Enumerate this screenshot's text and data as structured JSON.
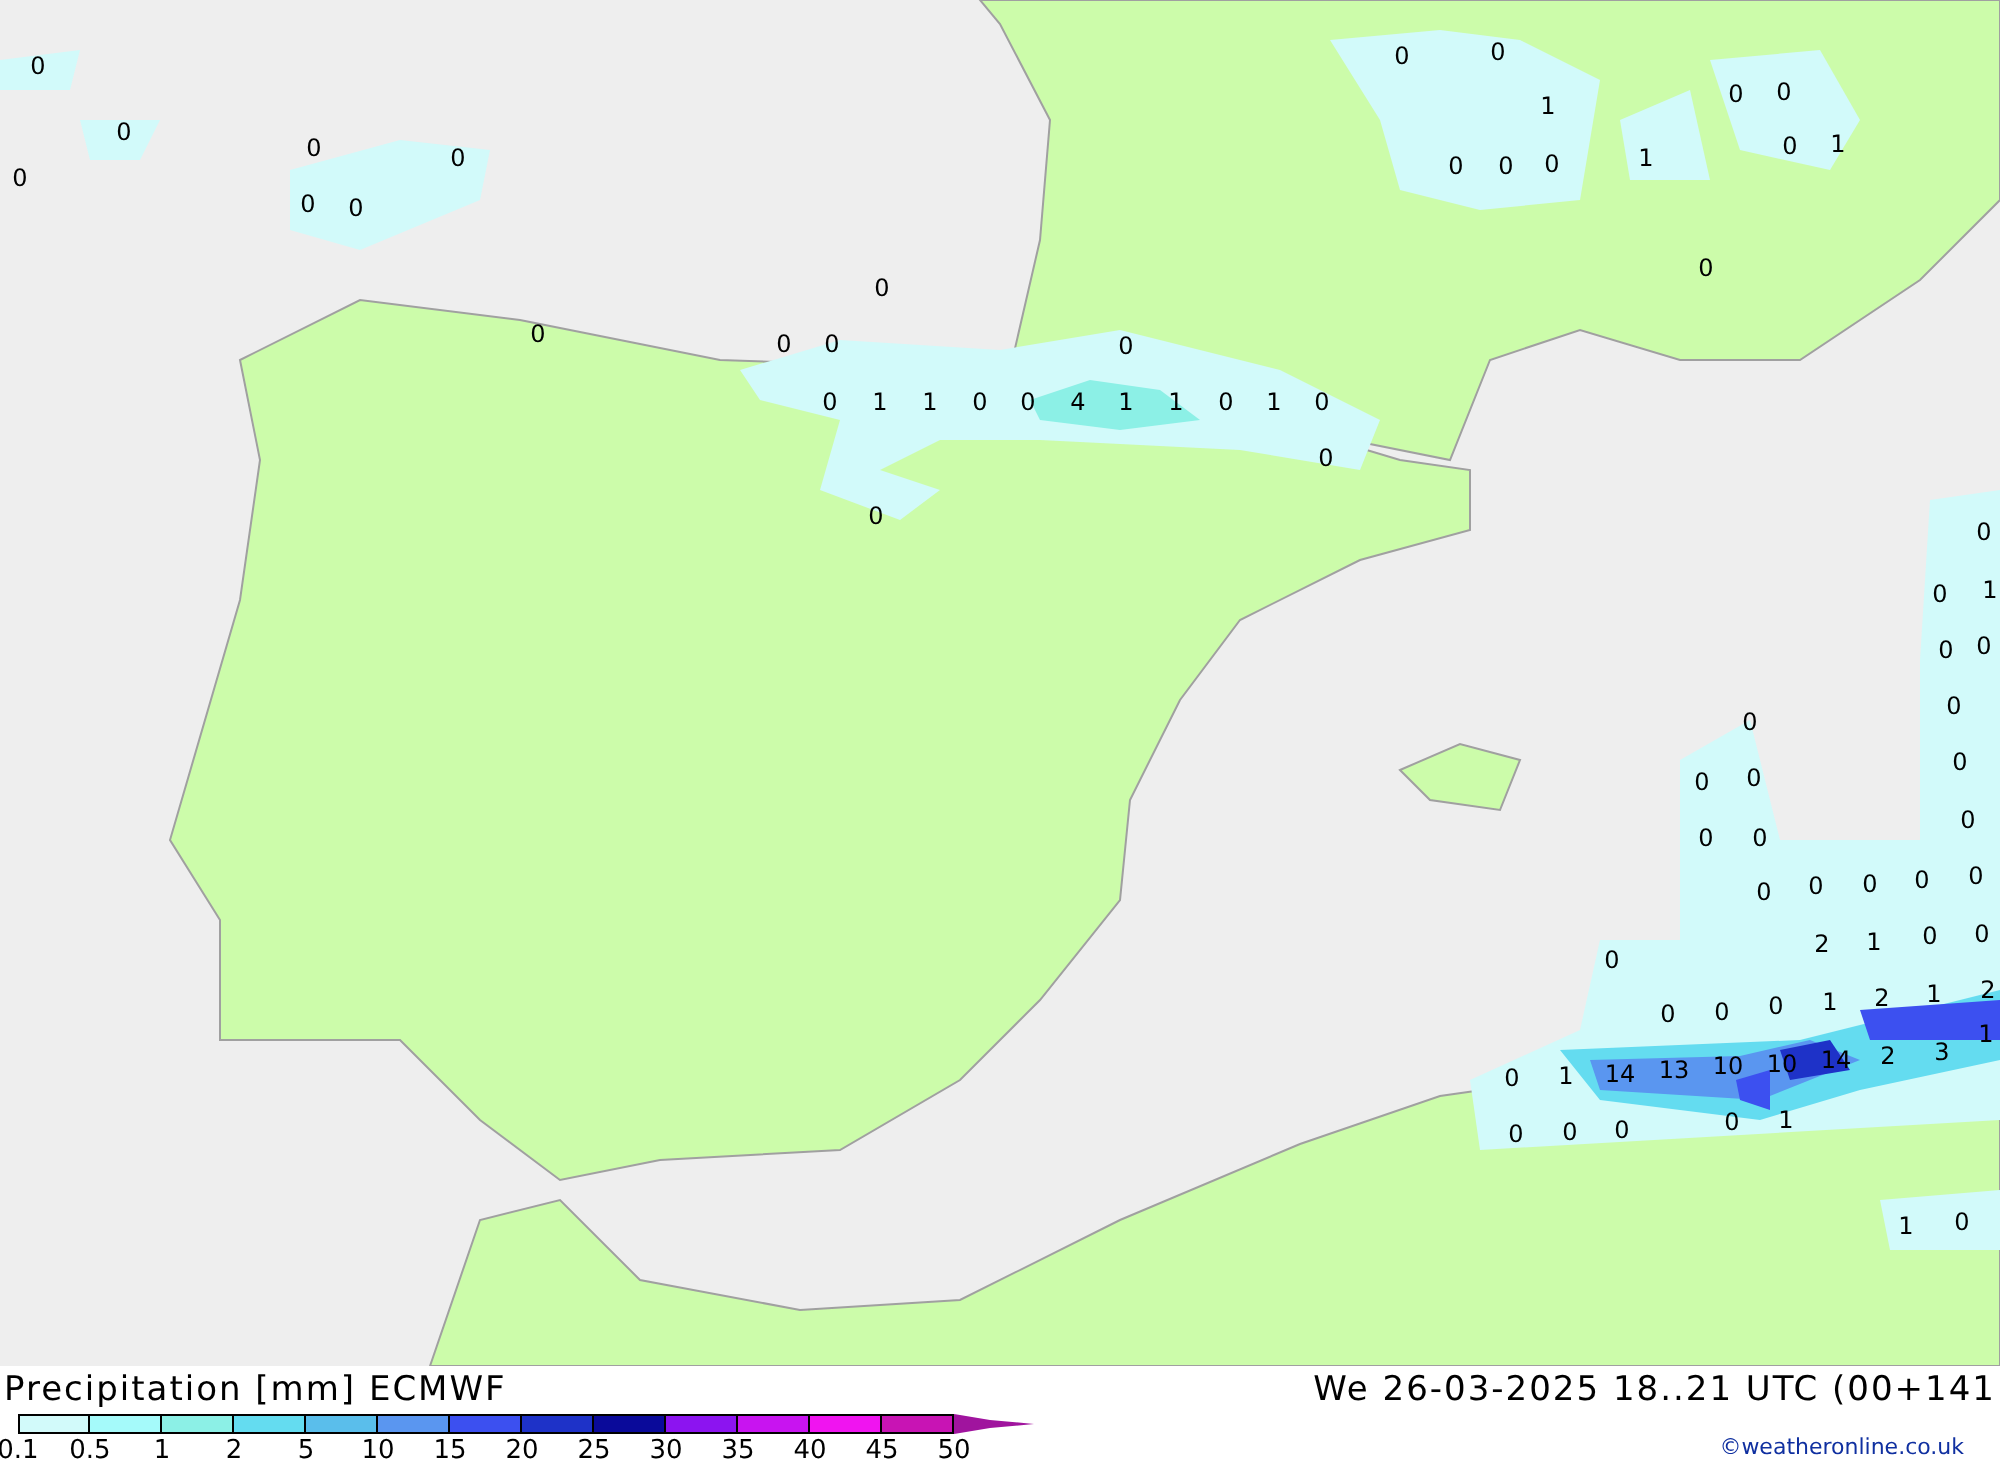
{
  "map": {
    "value_labels": [
      "0",
      "0",
      "0",
      "0",
      "0",
      "0",
      "0",
      "0",
      "0",
      "0",
      "0",
      "0",
      "0",
      "1",
      "1",
      "0",
      "0",
      "4",
      "1",
      "1",
      "0",
      "1",
      "0",
      "0",
      "0",
      "0",
      "0",
      "1",
      "1",
      "0",
      "0",
      "0",
      "1",
      "0",
      "0",
      "0",
      "0",
      "0",
      "1",
      "0",
      "0",
      "0",
      "0",
      "0",
      "0",
      "0",
      "0",
      "0",
      "0",
      "0",
      "0",
      "0",
      "0",
      "0",
      "0",
      "0",
      "0",
      "0",
      "2",
      "1",
      "0",
      "0",
      "0",
      "0",
      "0",
      "0",
      "1",
      "2",
      "1",
      "2",
      "14",
      "13",
      "10",
      "10",
      "14",
      "2",
      "3",
      "1",
      "0",
      "1",
      "0",
      "0",
      "1",
      "1"
    ]
  },
  "legend": {
    "title": "Precipitation [mm] ECMWF",
    "valid_time": "We 26-03-2025 18..21 UTC (00+141",
    "credit": "©weatheronline.co.uk",
    "scale": [
      {
        "label": "0.1",
        "color": "#d2fafa"
      },
      {
        "label": "0.5",
        "color": "#a5fafa"
      },
      {
        "label": "1",
        "color": "#8cf0e6"
      },
      {
        "label": "2",
        "color": "#64dcf0"
      },
      {
        "label": "5",
        "color": "#5abeeb"
      },
      {
        "label": "10",
        "color": "#5a96f0"
      },
      {
        "label": "15",
        "color": "#3c50f0"
      },
      {
        "label": "20",
        "color": "#1e32c8"
      },
      {
        "label": "25",
        "color": "#0a0a9a"
      },
      {
        "label": "30",
        "color": "#8c14f0"
      },
      {
        "label": "35",
        "color": "#c814f0"
      },
      {
        "label": "40",
        "color": "#f014f0"
      },
      {
        "label": "45",
        "color": "#c814b4"
      },
      {
        "label": "50",
        "color": "#a0149e"
      }
    ]
  }
}
